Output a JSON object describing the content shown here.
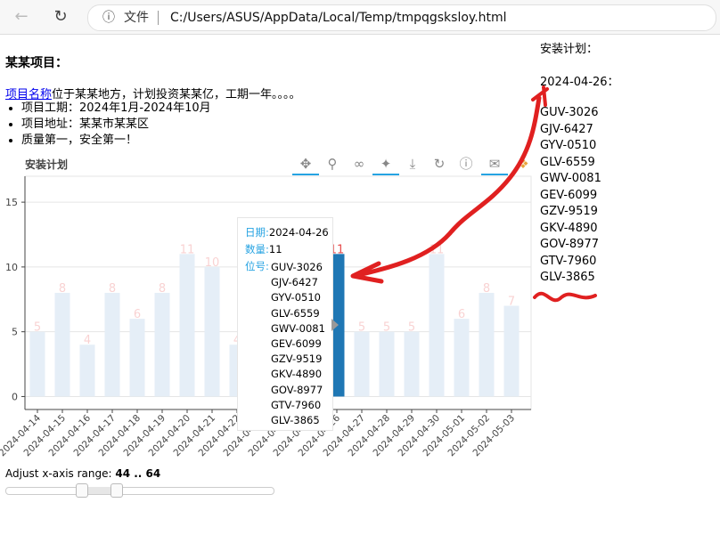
{
  "browser": {
    "scheme_label": "文件",
    "url": "C:/Users/ASUS/AppData/Local/Temp/tmpqgsksloy.html"
  },
  "project": {
    "heading": "某某项目：",
    "link_text": "项目名称",
    "description": "位于某某地方，计划投资某某亿，工期一年。。。。",
    "bullets": [
      "项目工期：2024年1月-2024年10月",
      "项目地址：某某市某某区",
      "质量第一，安全第一！"
    ]
  },
  "chart_title": "安装计划",
  "chart_data": {
    "type": "bar",
    "categories": [
      "2024-04-14",
      "2024-04-15",
      "2024-04-16",
      "2024-04-17",
      "2024-04-18",
      "2024-04-19",
      "2024-04-20",
      "2024-04-21",
      "2024-04-22",
      "2024-04-23",
      "2024-04-24",
      "2024-04-25",
      "2024-04-26",
      "2024-04-27",
      "2024-04-28",
      "2024-04-29",
      "2024-04-30",
      "2024-05-01",
      "2024-05-02",
      "2024-05-03"
    ],
    "values": [
      5,
      8,
      4,
      8,
      6,
      8,
      11,
      10,
      4,
      null,
      null,
      null,
      11,
      5,
      5,
      5,
      11,
      6,
      8,
      7
    ],
    "highlight_category": "2024-04-26",
    "yticks": [
      0,
      5,
      10,
      15
    ],
    "ylim": [
      -1,
      17
    ]
  },
  "tooltip": {
    "date_label": "日期:",
    "date_value": "2024-04-26",
    "count_label": "数量:",
    "count_value": "11",
    "codes_label": "位号:",
    "codes": [
      "GUV-3026",
      "GJV-6427",
      "GYV-0510",
      "GLV-6559",
      "GWV-0081",
      "GEV-6099",
      "GZV-9519",
      "GKV-4890",
      "GOV-8977",
      "GTV-7960",
      "GLV-3865"
    ]
  },
  "right_panel": {
    "title": "安装计划：",
    "date": "2024-04-26：",
    "codes": [
      "GUV-3026",
      "GJV-6427",
      "GYV-0510",
      "GLV-6559",
      "GWV-0081",
      "GEV-6099",
      "GZV-9519",
      "GKV-4890",
      "GOV-8977",
      "GTV-7960",
      "GLV-3865"
    ]
  },
  "slider": {
    "label": "Adjust x-axis range: ",
    "value": "44 .. 64"
  },
  "colors": {
    "bar": "#1f77b4",
    "bar_faded": "#e5eef7",
    "label": "#e64c4c",
    "annotation": "#e02020",
    "accent": "#26a3e2"
  }
}
